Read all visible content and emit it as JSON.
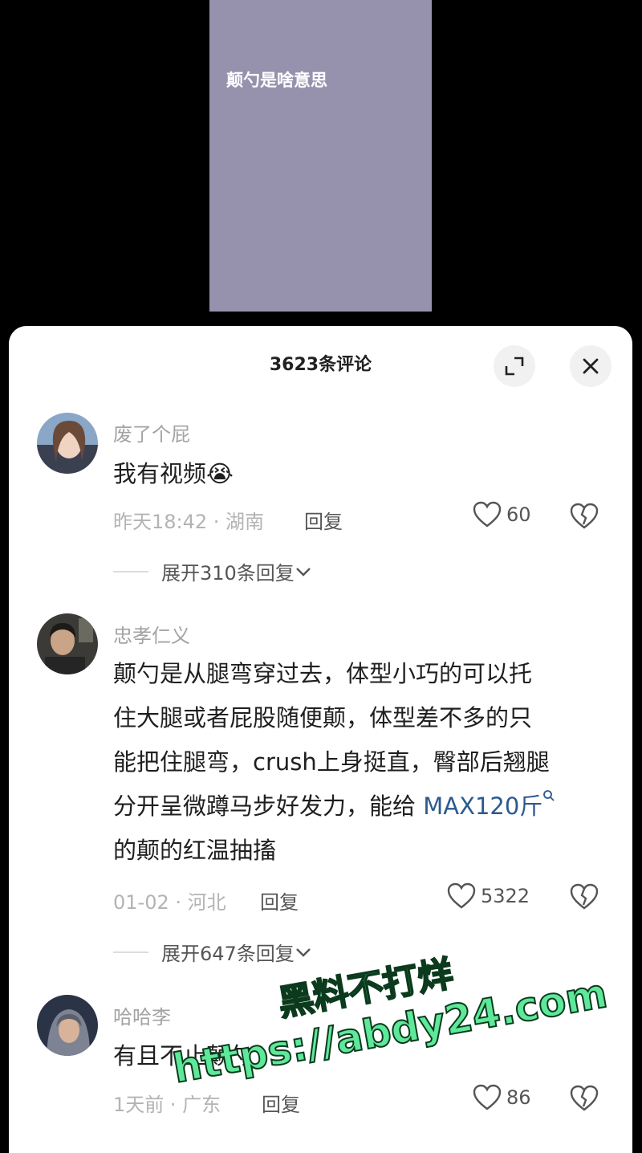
{
  "video": {
    "title": "颠勺是啥意思",
    "background": "#9692ae"
  },
  "comments_panel": {
    "title": "3623条评论",
    "expand_icon": "expand-icon",
    "close_icon": "close-icon"
  },
  "comments": [
    {
      "username": "废了个屁",
      "text": "我有视频",
      "emoji": "😭",
      "time_location": "昨天18:42 · 湖南",
      "reply_label": "回复",
      "likes": "60",
      "expand_replies": "展开310条回复"
    },
    {
      "username": "忠孝仁义",
      "text_lines": [
        "颠勺是从腿弯穿过去，体型小巧的可以托",
        "住大腿或者屁股随便颠，体型差不多的只",
        "能把住腿弯，crush上身挺直，臀部后翘腿",
        "分开呈微蹲马步好发力，能给 "
      ],
      "link_text": "MAX120斤",
      "text_last_line": "的颠的红温抽搐",
      "time_location": "01-02 · 河北",
      "reply_label": "回复",
      "likes": "5322",
      "expand_replies": "展开647条回复"
    },
    {
      "username": "哈哈李",
      "text": "有且不止颠勺",
      "time_location": "1天前 · 广东",
      "reply_label": "回复",
      "likes": "86"
    }
  ],
  "watermark": {
    "line1": "黑料不打烊",
    "line2": "https://abdy24.com",
    "color": "#5ee89a"
  }
}
